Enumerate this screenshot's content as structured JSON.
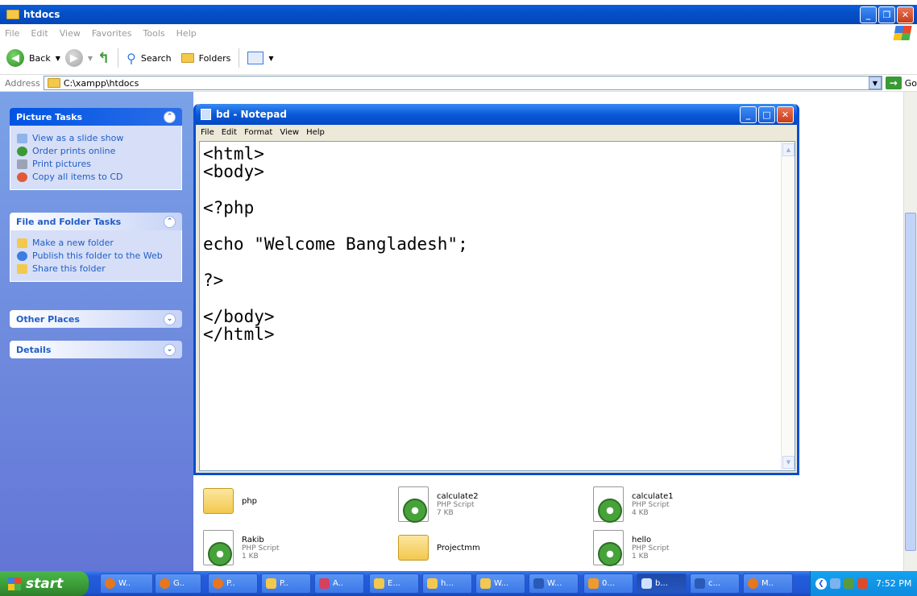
{
  "explorer": {
    "title": "htdocs",
    "menu": [
      "File",
      "Edit",
      "View",
      "Favorites",
      "Tools",
      "Help"
    ],
    "toolbar": {
      "back": "Back",
      "search": "Search",
      "folders": "Folders"
    },
    "address_label": "Address",
    "address_value": "C:\\xampp\\htdocs",
    "go": "Go"
  },
  "tasks": {
    "picture": {
      "title": "Picture Tasks",
      "items": [
        "View as a slide show",
        "Order prints online",
        "Print pictures",
        "Copy all items to CD"
      ]
    },
    "file_folder": {
      "title": "File and Folder Tasks",
      "items": [
        "Make a new folder",
        "Publish this folder to the Web",
        "Share this folder"
      ]
    },
    "other": {
      "title": "Other Places"
    },
    "details": {
      "title": "Details"
    }
  },
  "files": [
    {
      "name": "php",
      "type": "",
      "size": ""
    },
    {
      "name": "calculate2",
      "type": "PHP Script",
      "size": "7 KB"
    },
    {
      "name": "calculate1",
      "type": "PHP Script",
      "size": "4 KB"
    },
    {
      "name": "Rakib",
      "type": "PHP Script",
      "size": "1 KB"
    },
    {
      "name": "Projectmm",
      "type": "",
      "size": ""
    },
    {
      "name": "hello",
      "type": "PHP Script",
      "size": "1 KB"
    }
  ],
  "notepad": {
    "title": "bd - Notepad",
    "menu": [
      "File",
      "Edit",
      "Format",
      "View",
      "Help"
    ],
    "content": "<html>\n<body>\n\n<?php\n\necho \"Welcome Bangladesh\";\n\n?>\n\n</body>\n</html>"
  },
  "taskbar": {
    "start": "start",
    "tasks": [
      "W..",
      "G..",
      "P..",
      "P..",
      "A..",
      "E...",
      "h...",
      "W...",
      "W...",
      "0...",
      "b...",
      "c...",
      "M.."
    ],
    "clock": "7:52 PM"
  }
}
